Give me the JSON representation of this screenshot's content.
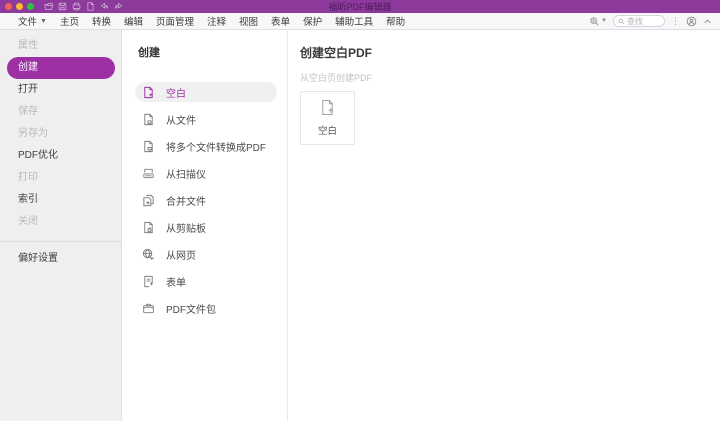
{
  "colors": {
    "titlebar": "#8c3a9b",
    "accent": "#9c30a4",
    "menubar_bg": "#f8f6f9",
    "sidebar_bg": "#efeff0"
  },
  "window": {
    "title": "福昕PDF编辑器"
  },
  "titlebar": {
    "icons": [
      "open-folder-icon",
      "save-icon",
      "print-icon",
      "new-document-icon",
      "undo-icon",
      "redo-icon"
    ]
  },
  "menubar": {
    "items": [
      {
        "label": "文件",
        "has_caret": true
      },
      {
        "label": "主页"
      },
      {
        "label": "转换"
      },
      {
        "label": "编辑"
      },
      {
        "label": "页面管理"
      },
      {
        "label": "注释"
      },
      {
        "label": "视图"
      },
      {
        "label": "表单"
      },
      {
        "label": "保护"
      },
      {
        "label": "辅助工具"
      },
      {
        "label": "帮助"
      }
    ],
    "search": {
      "placeholder": "查找"
    },
    "right_icons": [
      "advanced-search-icon",
      "search-icon",
      "more-icon",
      "account-icon",
      "collapse-icon"
    ]
  },
  "sidebar": {
    "items": [
      {
        "label": "属性",
        "state": "disabled"
      },
      {
        "label": "创建",
        "state": "selected"
      },
      {
        "label": "打开",
        "state": "enabled"
      },
      {
        "label": "保存",
        "state": "disabled"
      },
      {
        "label": "另存为",
        "state": "disabled"
      },
      {
        "label": "PDF优化",
        "state": "enabled"
      },
      {
        "label": "打印",
        "state": "disabled"
      },
      {
        "label": "索引",
        "state": "enabled"
      },
      {
        "label": "关闭",
        "state": "disabled"
      }
    ],
    "footer": {
      "label": "偏好设置"
    }
  },
  "create_panel": {
    "title": "创建",
    "items": [
      {
        "label": "空白",
        "icon": "blank-document-icon",
        "selected": true
      },
      {
        "label": "从文件",
        "icon": "from-file-icon"
      },
      {
        "label": "将多个文件转换成PDF",
        "icon": "multiple-files-icon"
      },
      {
        "label": "从扫描仪",
        "icon": "scanner-icon"
      },
      {
        "label": "合并文件",
        "icon": "merge-files-icon"
      },
      {
        "label": "从剪贴板",
        "icon": "clipboard-icon"
      },
      {
        "label": "从网页",
        "icon": "webpage-icon"
      },
      {
        "label": "表单",
        "icon": "form-icon"
      },
      {
        "label": "PDF文件包",
        "icon": "portfolio-icon"
      }
    ]
  },
  "detail_panel": {
    "title": "创建空白PDF",
    "subtitle": "从空白页创建PDF",
    "card": {
      "label": "空白",
      "icon": "blank-document-icon"
    }
  }
}
